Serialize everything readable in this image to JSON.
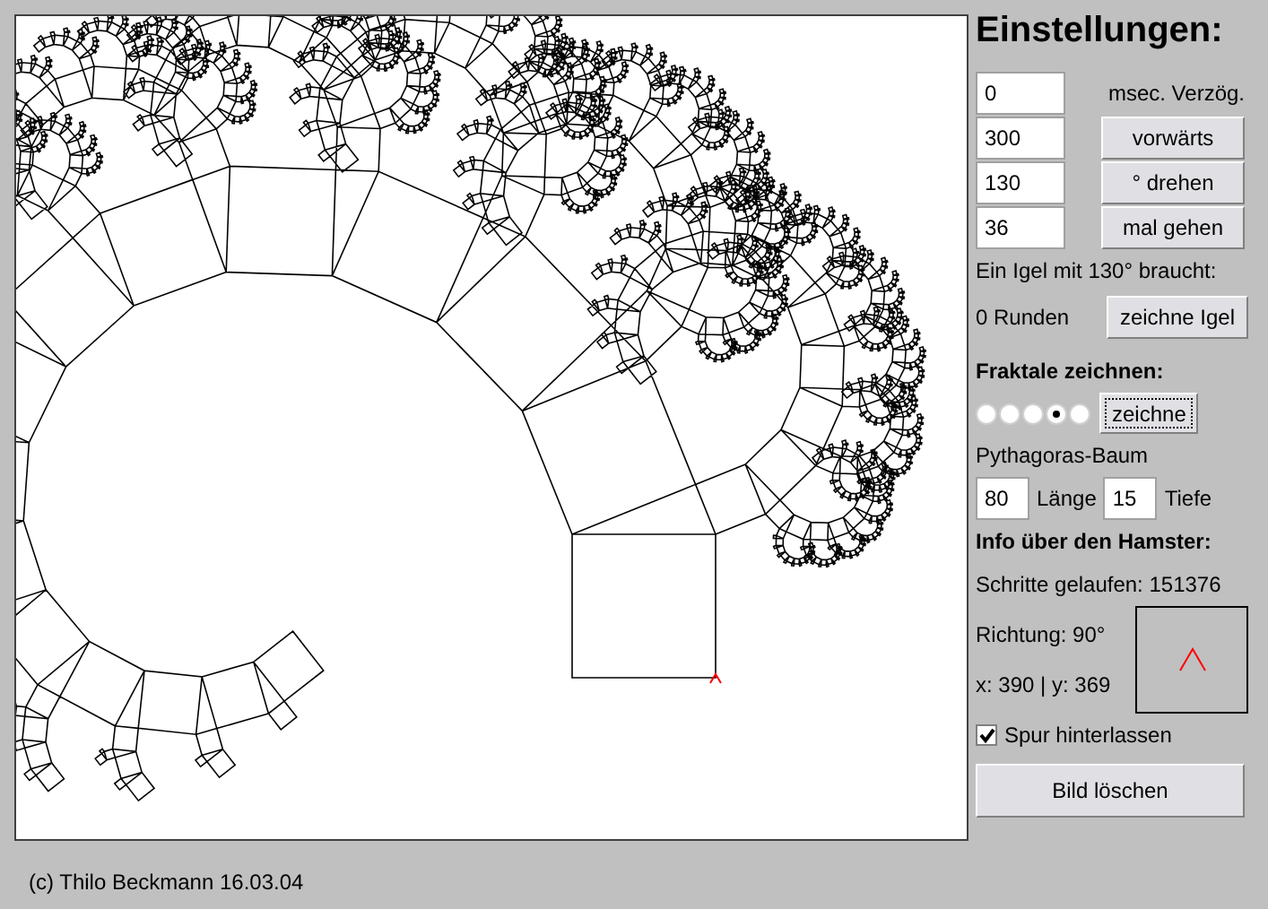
{
  "canvas": {
    "kind": "fractal"
  },
  "settings": {
    "title": "Einstellungen:",
    "rows": [
      {
        "value": "0",
        "kind": "label",
        "text": "msec. Verzög."
      },
      {
        "value": "300",
        "kind": "button",
        "text": "vorwärts"
      },
      {
        "value": "130",
        "kind": "button",
        "text": "° drehen"
      },
      {
        "value": "36",
        "kind": "button",
        "text": "mal gehen"
      }
    ],
    "hedgehog_note": "Ein Igel mit 130° braucht:",
    "rounds": "0 Runden",
    "hedgehog_button": "zeichne Igel"
  },
  "fractals": {
    "title": "Fraktale zeichnen:",
    "options": [
      {
        "selected": false
      },
      {
        "selected": false
      },
      {
        "selected": false
      },
      {
        "selected": true
      },
      {
        "selected": false
      }
    ],
    "draw_button": {
      "label": "zeichne",
      "focused": true
    },
    "name": "Pythagoras-Baum",
    "length": {
      "value": "80",
      "label": "Länge"
    },
    "depth": {
      "value": "15",
      "label": "Tiefe"
    }
  },
  "info": {
    "title": "Info über den Hamster:",
    "steps": "Schritte gelaufen: 151376",
    "direction": "Richtung: 90°",
    "position": "x: 390 | y: 369"
  },
  "trail": {
    "label": "Spur hinterlassen",
    "checked": true
  },
  "clear_button": "Bild löschen",
  "footer": "(c) Thilo Beckmann 16.03.04"
}
